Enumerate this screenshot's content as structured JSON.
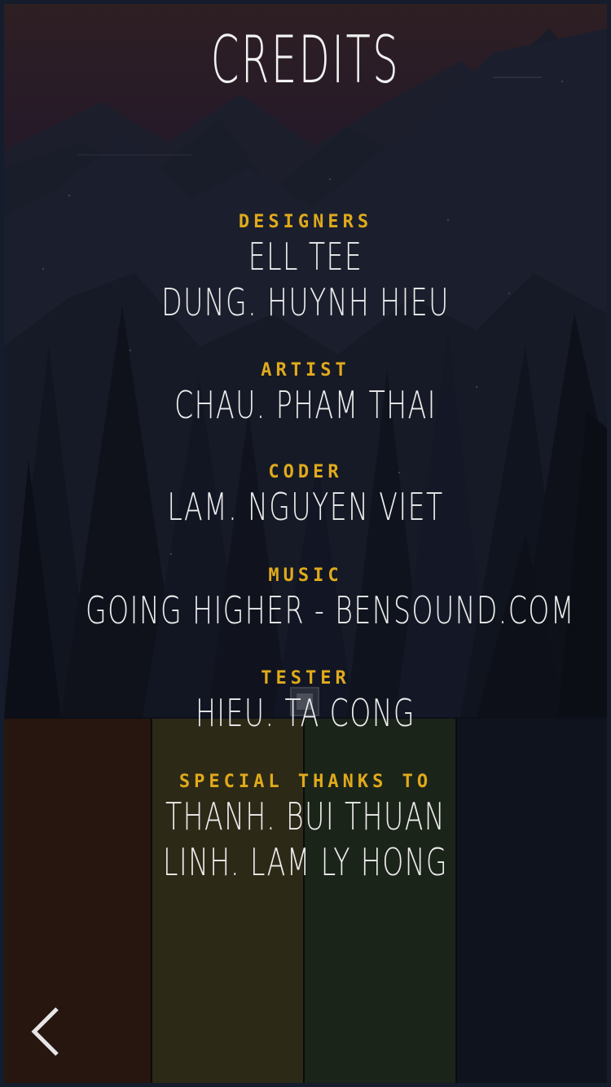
{
  "screen": {
    "title": "CREDITS",
    "colors": {
      "heading": "#e0aa1b",
      "name": "#ececec",
      "sky_top": "#2e1f23",
      "panel_red": "#27150f",
      "panel_olive": "#2d2917",
      "panel_green": "#1b2419",
      "panel_navy": "#0f131d"
    }
  },
  "credits": {
    "designers": {
      "heading": "DESIGNERS",
      "names": [
        "ELL TEE",
        "DUNG. HUYNH HIEU"
      ]
    },
    "artist": {
      "heading": "ARTIST",
      "names": [
        "CHAU. PHAM THAI"
      ]
    },
    "coder": {
      "heading": "CODER",
      "names": [
        "LAM. NGUYEN VIET"
      ]
    },
    "music": {
      "heading": "MUSIC",
      "names": [
        "GOING HIGHER - BENSOUND.COM"
      ]
    },
    "tester": {
      "heading": "TESTER",
      "names": [
        "HIEU. TA CONG"
      ]
    },
    "thanks": {
      "heading": "SPECIAL THANKS TO",
      "names": [
        "THANH. BUI THUAN",
        "LINH. LAM LY HONG"
      ]
    }
  },
  "nav": {
    "back_icon": "chevron-left-icon"
  }
}
